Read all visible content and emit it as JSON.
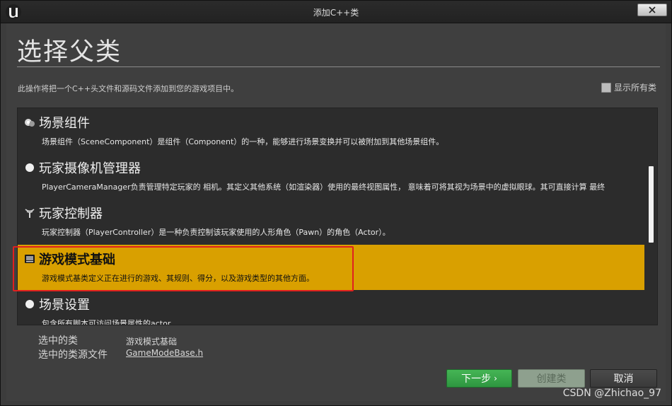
{
  "window": {
    "title": "添加C++类",
    "logo_icon": "unreal-engine-logo-icon",
    "close_icon": "close-icon"
  },
  "header": {
    "title": "选择父类",
    "description": "此操作将把一个C++头文件和源码文件添加到您的游戏项目中。",
    "show_all_label": "显示所有类",
    "show_all_checked": false
  },
  "class_list": {
    "items": [
      {
        "icon": "scene-component-icon",
        "title": "场景组件",
        "description": "场景组件（SceneComponent）是组件（Component）的一种，能够进行场景变换并可以被附加到其他场景组件。",
        "selected": false
      },
      {
        "icon": "camera-manager-icon",
        "title": "玩家摄像机管理器",
        "description": "PlayerCameraManager负责管理特定玩家的 相机。其定义其他系统（如渲染器）使用的最终视图属性， 意味着可将其视为场景中的虚拟眼球。其可直接计算 最终",
        "selected": false
      },
      {
        "icon": "player-controller-icon",
        "title": "玩家控制器",
        "description": "玩家控制器（PlayerController）是一种负责控制该玩家使用的人形角色（Pawn）的角色（Actor）。",
        "selected": false
      },
      {
        "icon": "game-mode-icon",
        "title": "游戏模式基础",
        "description": "游戏模式基类定义正在进行的游戏、其规则、得分，以及游戏类型的其他方面。",
        "selected": true
      },
      {
        "icon": "world-settings-icon",
        "title": "场景设置",
        "description": "包含所有脚本可访问场景属性的actor",
        "selected": false
      }
    ],
    "selected_color": "#d9a000"
  },
  "selection": {
    "class_label": "选中的类",
    "class_value": "游戏模式基础",
    "source_label": "选中的类源文件",
    "source_value": "GameModeBase.h"
  },
  "buttons": {
    "next_label": "下一步",
    "next_arrow": "›",
    "create_label": "创建类",
    "cancel_label": "取消"
  },
  "watermark": "CSDN @Zhichao_97"
}
